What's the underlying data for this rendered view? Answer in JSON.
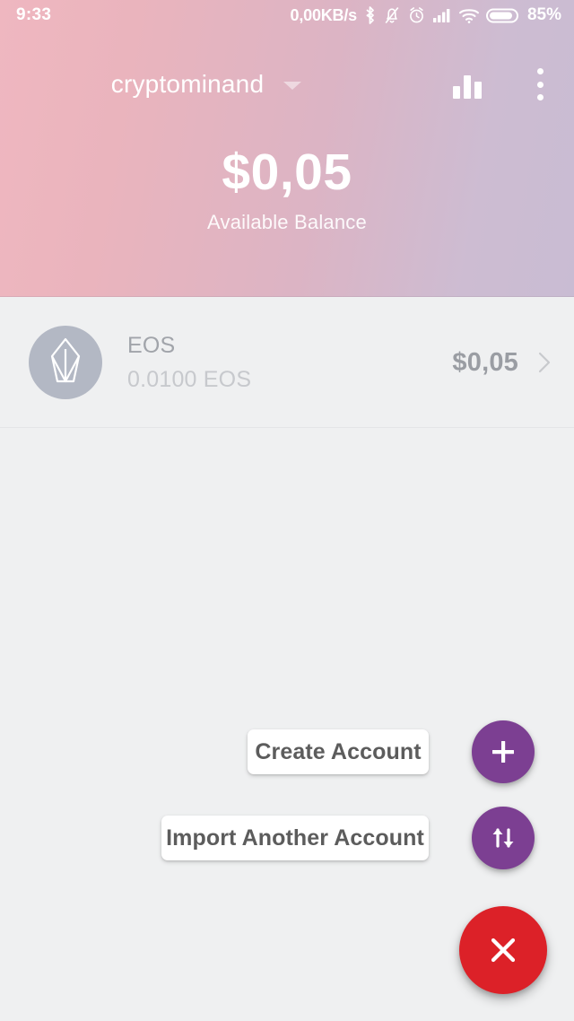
{
  "status_bar": {
    "time": "9:33",
    "network_speed": "0,00KB/s",
    "battery_percent": "85%",
    "icons": [
      "bluetooth-icon",
      "bell-muted-icon",
      "alarm-clock-icon",
      "cellular-signal-icon",
      "wifi-icon",
      "battery-icon"
    ]
  },
  "app_bar": {
    "account_name": "cryptominand",
    "account_dropdown_icon": "chevron-down-icon",
    "chart_icon": "bar-chart-icon",
    "overflow_icon": "more-vertical-icon"
  },
  "balance": {
    "amount": "$0,05",
    "label": "Available Balance"
  },
  "tokens": [
    {
      "symbol": "EOS",
      "amount": "0.0100 EOS",
      "fiat_value": "$0,05",
      "logo": "eos-logo-icon",
      "chevron": "chevron-right-icon"
    }
  ],
  "fab_menu": {
    "expanded": true,
    "actions": [
      {
        "label": "Create Account",
        "icon": "plus-icon"
      },
      {
        "label": "Import Another Account",
        "icon": "import-arrows-icon"
      }
    ],
    "main_action": {
      "icon": "close-icon",
      "color": "#dc2128"
    },
    "accent_color": "#7c3f92"
  },
  "colors": {
    "header_gradient_start": "#efb7c0",
    "header_gradient_end": "#c9bcd3",
    "body_background": "#eff0f1",
    "fab_purple": "#7c3f92",
    "fab_red": "#dc2128"
  }
}
